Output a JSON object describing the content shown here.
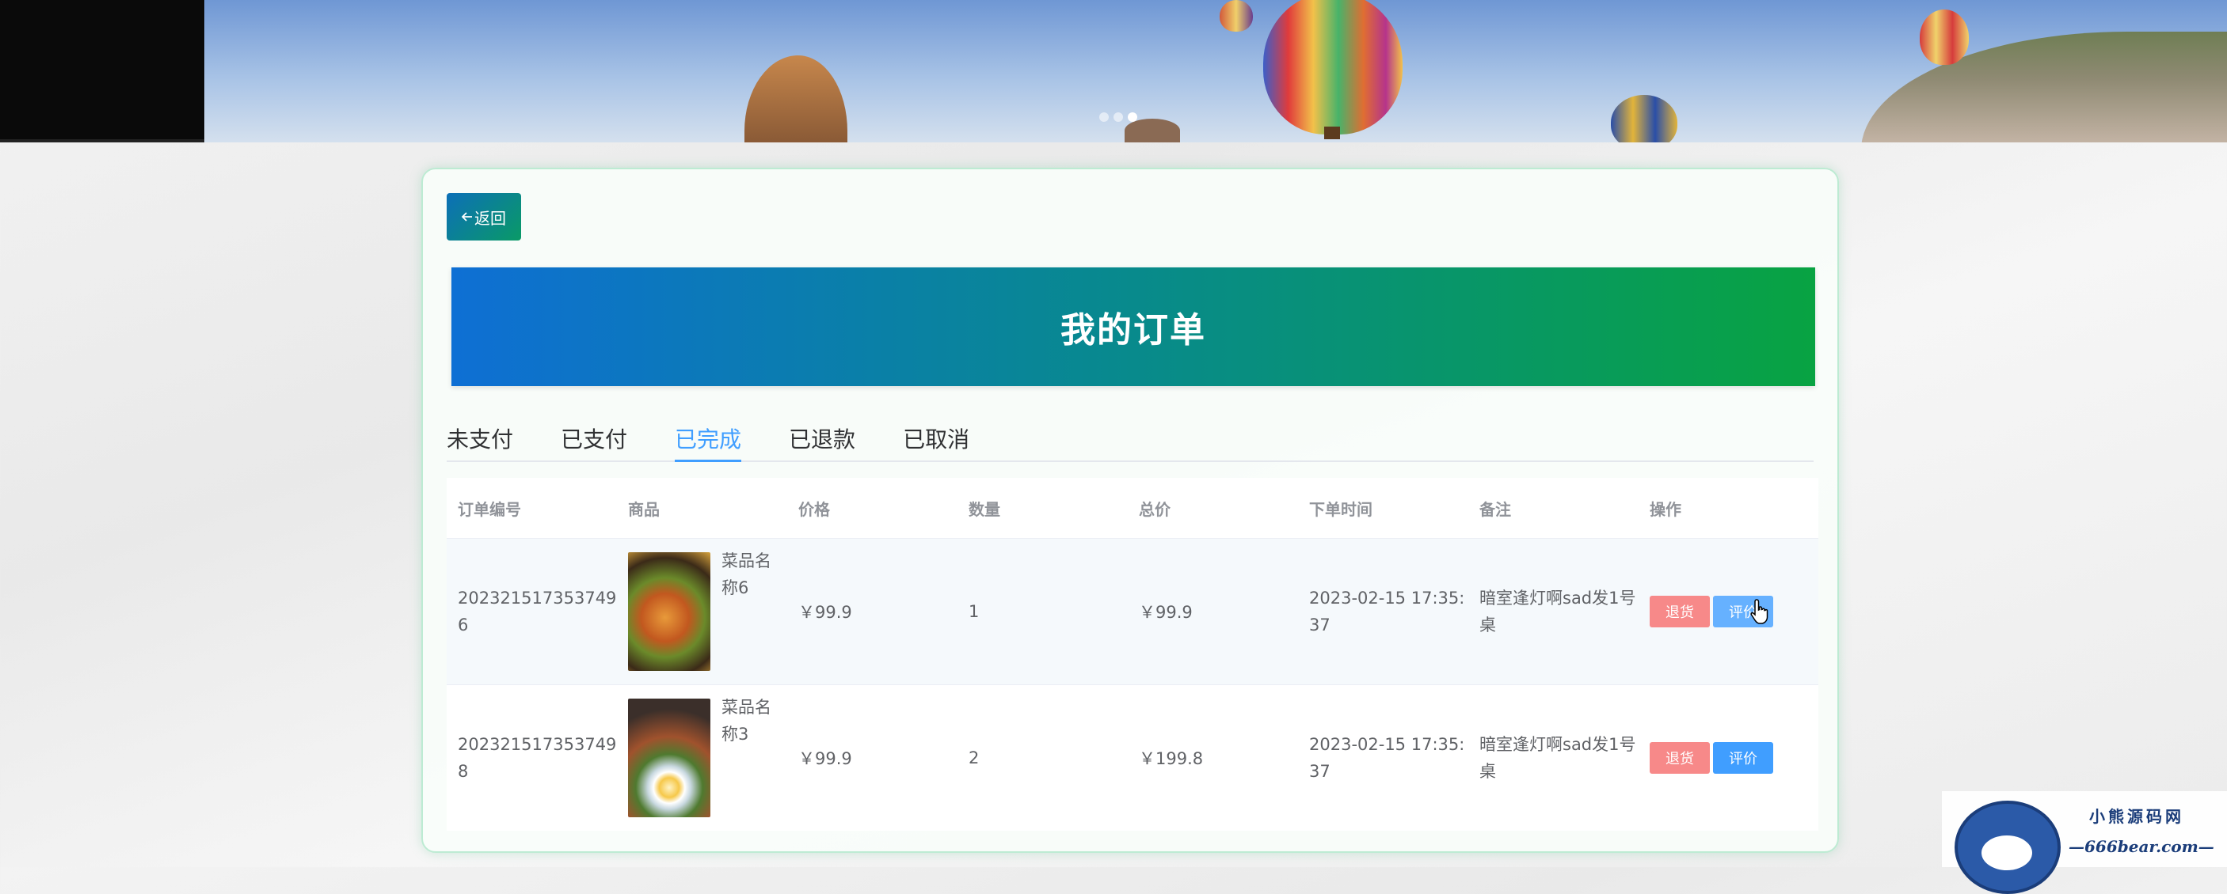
{
  "header": {
    "back_label": "返回",
    "title": "我的订单"
  },
  "tabs": [
    {
      "label": "未支付",
      "active": false
    },
    {
      "label": "已支付",
      "active": false
    },
    {
      "label": "已完成",
      "active": true
    },
    {
      "label": "已退款",
      "active": false
    },
    {
      "label": "已取消",
      "active": false
    }
  ],
  "table": {
    "columns": [
      "订单编号",
      "商品",
      "价格",
      "数量",
      "总价",
      "下单时间",
      "备注",
      "操作"
    ],
    "rows": [
      {
        "order_no": "2023215173537496",
        "goods_name": "菜品名称6",
        "price": "￥99.9",
        "quantity": "1",
        "total": "￥99.9",
        "time": "2023-02-15 17:35:37",
        "remark": "暗室逢灯啊sad发1号桌",
        "refund_label": "退货",
        "review_label": "评价"
      },
      {
        "order_no": "2023215173537498",
        "goods_name": "菜品名称3",
        "price": "￥99.9",
        "quantity": "2",
        "total": "￥199.8",
        "time": "2023-02-15 17:35:37",
        "remark": "暗室逢灯啊sad发1号桌",
        "refund_label": "退货",
        "review_label": "评价"
      }
    ]
  },
  "watermark": {
    "line1": "小熊源码网",
    "line2": "—666bear.com—"
  },
  "colors": {
    "primary": "#409eff",
    "danger": "#f78989",
    "title_gradient_start": "#0e6fd4",
    "title_gradient_end": "#08a342"
  },
  "icons": {
    "back": "arrow-left-icon",
    "cursor": "hand-pointer-icon"
  }
}
